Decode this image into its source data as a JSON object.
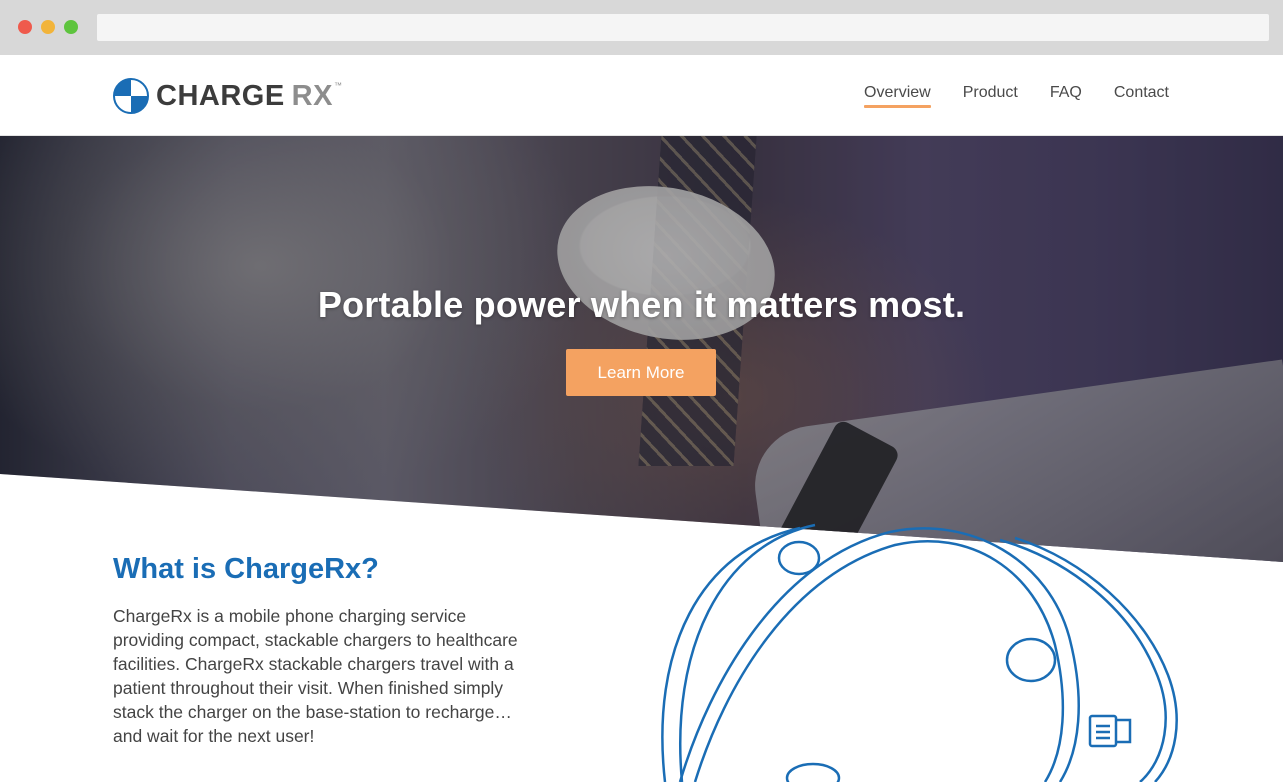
{
  "brand": {
    "name_primary": "CHARGE",
    "name_secondary": "RX",
    "trademark": "™",
    "colors": {
      "blue": "#1a6db5",
      "orange": "#f4a261",
      "dark": "#3c3c3c",
      "gray": "#8d8d8d"
    }
  },
  "nav": {
    "items": [
      {
        "label": "Overview",
        "active": true
      },
      {
        "label": "Product",
        "active": false
      },
      {
        "label": "FAQ",
        "active": false
      },
      {
        "label": "Contact",
        "active": false
      }
    ]
  },
  "hero": {
    "title": "Portable power when it matters most.",
    "button_label": "Learn More"
  },
  "about": {
    "title": "What is ChargeRx?",
    "body": "ChargeRx is a mobile phone charging service providing compact, stackable chargers to healthcare facilities. ChargeRx stackable chargers travel with a patient throughout their visit. When finished simply stack the charger on the base-station to recharge…and wait for the next user!"
  },
  "icons": {
    "logo": "chargerx-logo-mark",
    "illustration": "charger-device-illustration"
  }
}
